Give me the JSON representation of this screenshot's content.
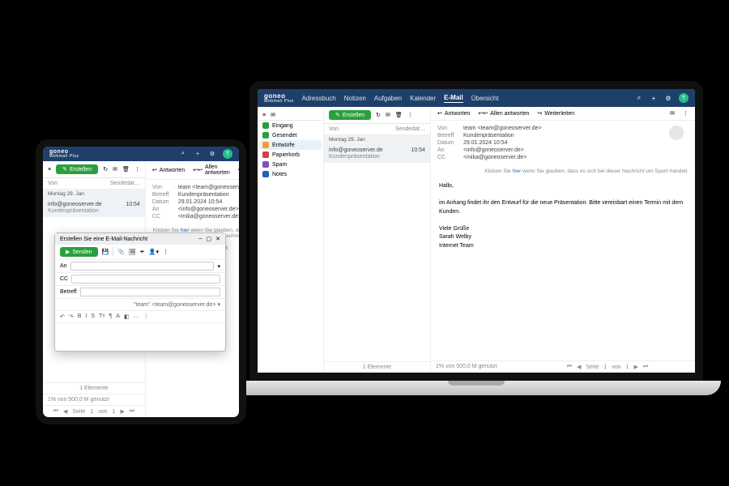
{
  "brand": {
    "name": "goneo",
    "sub": "Webmail Plus",
    "avatar_initial": "T"
  },
  "nav": {
    "items": [
      "Adressbuch",
      "Notizen",
      "Aufgaben",
      "Kalender",
      "E-Mail",
      "Übersicht"
    ],
    "active": "E-Mail"
  },
  "topicons": {
    "search": "⌕",
    "plus": "+",
    "settings": "⚙"
  },
  "compose_btn": "Erstellen",
  "toolbar_icons": {
    "refresh": "↻",
    "envelope": "✉",
    "trash": "🗑",
    "more": "⋮"
  },
  "sidebar": {
    "items": [
      {
        "label": "Eingang",
        "cls": "d-in"
      },
      {
        "label": "Gesendet",
        "cls": "d-out"
      },
      {
        "label": "Entwürfe",
        "cls": "d-dr",
        "sel": true
      },
      {
        "label": "Papierkorb",
        "cls": "d-tr"
      },
      {
        "label": "Spam",
        "cls": "d-sp"
      },
      {
        "label": "Notes",
        "cls": "d-no"
      }
    ]
  },
  "list": {
    "hdr_from": "Von",
    "hdr_date": "Sendedat…",
    "day": "Montag 29. Jan",
    "msg": {
      "from": "info@goneoserver.de",
      "subj": "Kundenpräsentation",
      "time": "10:54"
    },
    "footer": "1 Elemente"
  },
  "reader": {
    "reply": "Antworten",
    "reply_all": "Allen antworten",
    "forward": "Weiterleiten",
    "meta": {
      "from_k": "Von",
      "from_v": "team <team@goneoserver.de>",
      "subj_k": "Betreff",
      "subj_v": "Kundenpräsentation",
      "date_k": "Datum",
      "date_v": "29.01.2024 10:54",
      "to_k": "An",
      "to_v": "<info@goneoserver.de>",
      "cc_k": "CC",
      "cc_v": "<mika@goneoserver.de>"
    },
    "spam_pre": "Klicken Sie ",
    "spam_link": "hier",
    "spam_post": " wenn Sie glauben, dass es sich bei dieser Nachricht um Spam handelt.",
    "body_greet": "Hallo,",
    "body_line": "im Anhang findet ihr den Entwurf für die neue Präsentation. Bitte vereinbart einen Termin mit dem Kunden.",
    "body_off1": "Viele Grüße",
    "body_off2": "Sarah Welby",
    "body_off3": "Internet Team"
  },
  "quota": "1% von 500,0 M genutzt",
  "pager": {
    "page_lbl": "Seite",
    "page": "1",
    "of_lbl": "von",
    "of": "1"
  },
  "compose": {
    "title": "Erstellen Sie eine E-Mail-Nachricht",
    "send": "Senden",
    "to": "An",
    "cc": "CC",
    "subj": "Betreff",
    "sig": "\"team\" <team@goneoserver.de>",
    "fmt": [
      "↶",
      "↷",
      "B",
      "I",
      "S",
      "Tт",
      "¶",
      "A",
      "◧",
      "…",
      "⋮"
    ]
  },
  "tablet_body_hint": "vereinbart einen Termin"
}
